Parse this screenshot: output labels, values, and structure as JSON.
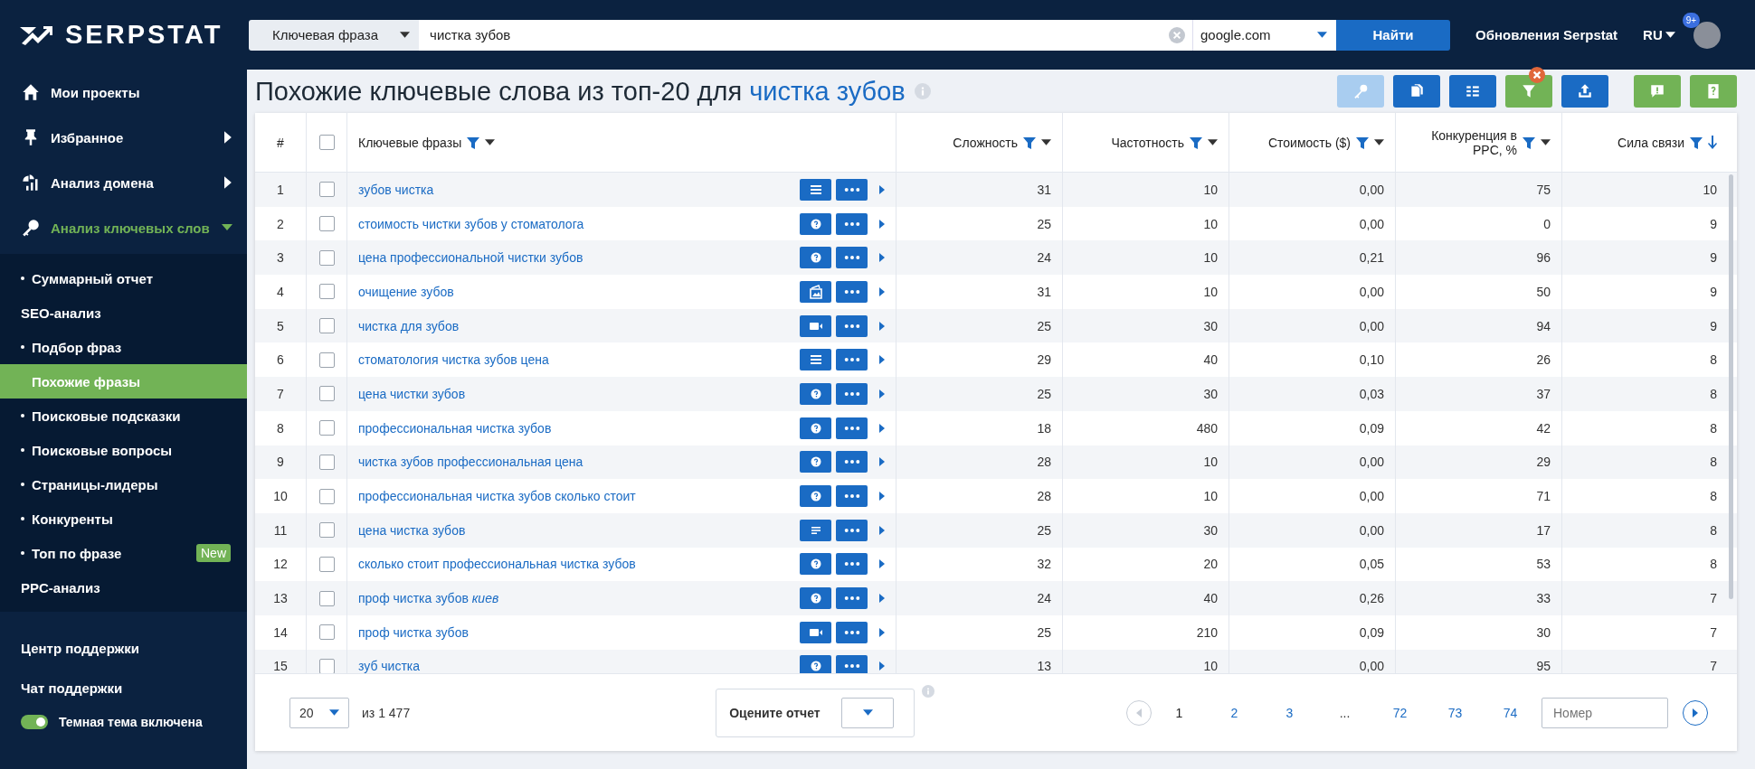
{
  "sidebar": {
    "logo": "SERPSTAT",
    "nav": [
      {
        "label": "Мои проекты",
        "kind": "home"
      },
      {
        "label": "Избранное",
        "kind": "pin",
        "expanded": false
      },
      {
        "label": "Анализ домена",
        "kind": "chart",
        "expanded": false
      },
      {
        "label": "Анализ ключевых слов",
        "kind": "key",
        "expanded": true
      }
    ],
    "submenu": [
      {
        "label": "Суммарный отчет",
        "kind": "link",
        "selected": false
      },
      {
        "label": "SEO-анализ",
        "kind": "heading"
      },
      {
        "label": "Подбор фраз",
        "kind": "link",
        "selected": false
      },
      {
        "label": "Похожие фразы",
        "kind": "link",
        "selected": true
      },
      {
        "label": "Поисковые подсказки",
        "kind": "link",
        "selected": false
      },
      {
        "label": "Поисковые вопросы",
        "kind": "link",
        "selected": false
      },
      {
        "label": "Страницы-лидеры",
        "kind": "link",
        "selected": false
      },
      {
        "label": "Конкуренты",
        "kind": "link",
        "selected": false
      },
      {
        "label": "Топ по фразе",
        "kind": "link",
        "selected": false,
        "badge": "New"
      },
      {
        "label": "PPC-анализ",
        "kind": "heading"
      }
    ],
    "bottom": [
      "Центр поддержки",
      "Чат поддержки"
    ],
    "theme_toggle": {
      "label": "Темная тема включена",
      "on": true
    }
  },
  "topbar": {
    "search_type": "Ключевая фраза",
    "query": "чистка зубов",
    "engine": "google.com",
    "search_button": "Найти",
    "updates": "Обновления Serpstat",
    "language": "RU",
    "notifications": "9+"
  },
  "title": {
    "text": "Похожие ключевые слова из топ-20 для",
    "keyword": "чистка зубов"
  },
  "tools": [
    {
      "kind": "key",
      "disabled": true,
      "active": false
    },
    {
      "kind": "copy",
      "disabled": false,
      "active": false
    },
    {
      "kind": "columns",
      "disabled": false,
      "active": false
    },
    {
      "kind": "filter",
      "disabled": false,
      "active": true
    },
    {
      "kind": "export",
      "disabled": false,
      "active": false
    }
  ],
  "help_tools": [
    {
      "kind": "feedback"
    },
    {
      "kind": "guide"
    }
  ],
  "table": {
    "select_all_checked": false,
    "columns": [
      {
        "label": "#",
        "kind": "number"
      },
      {
        "label": "Ключевые фразы",
        "kind": "keyword",
        "sorted": false
      },
      {
        "label": "Сложность",
        "kind": "metric",
        "sorted": false
      },
      {
        "label": "Частотность",
        "kind": "metric",
        "sorted": false
      },
      {
        "label": "Стоимость ($)",
        "kind": "metric",
        "sorted": false
      },
      {
        "label": "Конкуренция в PPC, %",
        "kind": "metric",
        "sorted": false
      },
      {
        "label": "Сила связи",
        "kind": "metric",
        "sorted": true
      }
    ],
    "rows": [
      {
        "n": "1",
        "keyword": "зубов чистка",
        "kind": "list",
        "checked": false,
        "values": [
          "31",
          "10",
          "0,00",
          "75",
          "10"
        ]
      },
      {
        "n": "2",
        "keyword": "стоимость чистки зубов у стоматолога",
        "kind": "question",
        "checked": false,
        "values": [
          "25",
          "10",
          "0,00",
          "0",
          "9"
        ]
      },
      {
        "n": "3",
        "keyword": "цена профессиональной чистки зубов",
        "kind": "question",
        "checked": false,
        "values": [
          "24",
          "10",
          "0,21",
          "96",
          "9"
        ]
      },
      {
        "n": "4",
        "keyword": "очищение зубов",
        "kind": "image",
        "checked": false,
        "values": [
          "31",
          "10",
          "0,00",
          "50",
          "9"
        ]
      },
      {
        "n": "5",
        "keyword": "чистка для зубов",
        "kind": "video",
        "checked": false,
        "values": [
          "25",
          "30",
          "0,00",
          "94",
          "9"
        ]
      },
      {
        "n": "6",
        "keyword": "стоматология чистка зубов цена",
        "kind": "list",
        "checked": false,
        "values": [
          "29",
          "40",
          "0,10",
          "26",
          "8"
        ]
      },
      {
        "n": "7",
        "keyword": "цена чистки зубов",
        "kind": "question",
        "checked": false,
        "values": [
          "25",
          "30",
          "0,03",
          "37",
          "8"
        ]
      },
      {
        "n": "8",
        "keyword": "профессиональная чистка зубов",
        "kind": "question",
        "checked": false,
        "values": [
          "18",
          "480",
          "0,09",
          "42",
          "8"
        ]
      },
      {
        "n": "9",
        "keyword": "чистка зубов профессиональная цена",
        "kind": "question",
        "checked": false,
        "values": [
          "28",
          "10",
          "0,00",
          "29",
          "8"
        ]
      },
      {
        "n": "10",
        "keyword": "профессиональная чистка зубов сколько стоит",
        "kind": "question",
        "checked": false,
        "values": [
          "28",
          "10",
          "0,00",
          "71",
          "8"
        ]
      },
      {
        "n": "11",
        "keyword": "цена чистка зубов",
        "kind": "snippet",
        "checked": false,
        "values": [
          "25",
          "30",
          "0,00",
          "17",
          "8"
        ]
      },
      {
        "n": "12",
        "keyword": "сколько стоит профессиональная чистка зубов",
        "kind": "question",
        "checked": false,
        "values": [
          "32",
          "20",
          "0,05",
          "53",
          "8"
        ]
      },
      {
        "n": "13",
        "keyword": "проф чистка зубов *киев*",
        "kind": "question",
        "checked": false,
        "values": [
          "24",
          "40",
          "0,26",
          "33",
          "7"
        ]
      },
      {
        "n": "14",
        "keyword": "проф чистка зубов",
        "kind": "video",
        "checked": false,
        "values": [
          "25",
          "210",
          "0,09",
          "30",
          "7"
        ]
      },
      {
        "n": "15",
        "keyword": "зуб чистка",
        "kind": "question",
        "checked": false,
        "values": [
          "13",
          "10",
          "0,00",
          "95",
          "7"
        ]
      }
    ]
  },
  "footer": {
    "per_page": "20",
    "total": "из 1 477",
    "rating_label": "Оцените отчет",
    "pages": [
      {
        "label": "1",
        "kind": "page",
        "selected": true
      },
      {
        "label": "2",
        "kind": "page",
        "selected": false
      },
      {
        "label": "3",
        "kind": "page",
        "selected": false
      },
      {
        "label": "...",
        "kind": "gap"
      },
      {
        "label": "72",
        "kind": "page",
        "selected": false
      },
      {
        "label": "73",
        "kind": "page",
        "selected": false
      },
      {
        "label": "74",
        "kind": "page",
        "selected": false
      }
    ],
    "prev_disabled": true,
    "page_input_placeholder": "Номер"
  }
}
